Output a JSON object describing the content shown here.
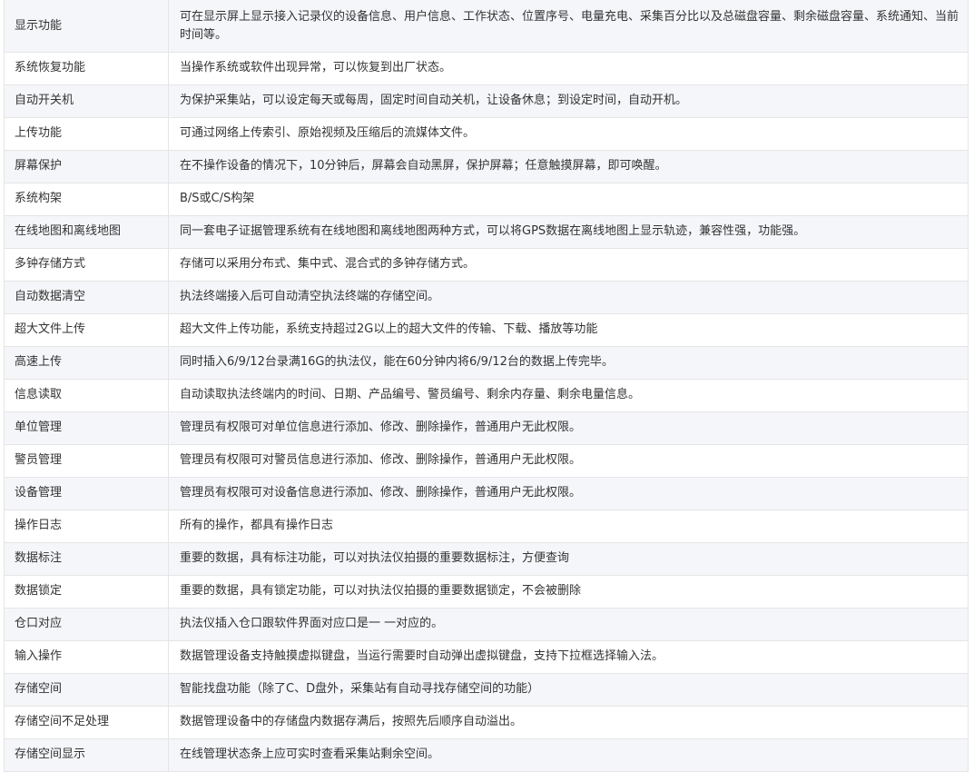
{
  "rows": [
    {
      "feature": "显示功能",
      "description": "可在显示屏上显示接入记录仪的设备信息、用户信息、工作状态、位置序号、电量充电、采集百分比以及总磁盘容量、剩余磁盘容量、系统通知、当前时间等。"
    },
    {
      "feature": "系统恢复功能",
      "description": "当操作系统或软件出现异常，可以恢复到出厂状态。"
    },
    {
      "feature": "自动开关机",
      "description": "为保护采集站，可以设定每天或每周，固定时间自动关机，让设备休息；到设定时间，自动开机。"
    },
    {
      "feature": "上传功能",
      "description": "可通过网络上传索引、原始视频及压缩后的流媒体文件。"
    },
    {
      "feature": "屏幕保护",
      "description": "在不操作设备的情况下，10分钟后，屏幕会自动黑屏，保护屏幕；任意触摸屏幕，即可唤醒。"
    },
    {
      "feature": "系统构架",
      "description": "B/S或C/S构架"
    },
    {
      "feature": "在线地图和离线地图",
      "description": "同一套电子证据管理系统有在线地图和离线地图两种方式，可以将GPS数据在离线地图上显示轨迹，兼容性强，功能强。"
    },
    {
      "feature": "多钟存储方式",
      "description": "存储可以采用分布式、集中式、混合式的多钟存储方式。"
    },
    {
      "feature": "自动数据清空",
      "description": "执法终端接入后可自动清空执法终端的存储空间。"
    },
    {
      "feature": "超大文件上传",
      "description": "超大文件上传功能，系统支持超过2G以上的超大文件的传输、下载、播放等功能"
    },
    {
      "feature": "高速上传",
      "description": "同时插入6/9/12台录满16G的执法仪，能在60分钟内将6/9/12台的数据上传完毕。"
    },
    {
      "feature": "信息读取",
      "description": "自动读取执法终端内的时间、日期、产品编号、警员编号、剩余内存量、剩余电量信息。"
    },
    {
      "feature": "单位管理",
      "description": "管理员有权限可对单位信息进行添加、修改、删除操作，普通用户无此权限。"
    },
    {
      "feature": "警员管理",
      "description": "管理员有权限可对警员信息进行添加、修改、删除操作，普通用户无此权限。"
    },
    {
      "feature": "设备管理",
      "description": "管理员有权限可对设备信息进行添加、修改、删除操作，普通用户无此权限。"
    },
    {
      "feature": "操作日志",
      "description": "所有的操作，都具有操作日志"
    },
    {
      "feature": "数据标注",
      "description": "重要的数据，具有标注功能，可以对执法仪拍摄的重要数据标注，方便查询"
    },
    {
      "feature": "数据锁定",
      "description": "重要的数据，具有锁定功能，可以对执法仪拍摄的重要数据锁定，不会被删除"
    },
    {
      "feature": "仓口对应",
      "description": "执法仪插入仓口跟软件界面对应口是一 一对应的。"
    },
    {
      "feature": "输入操作",
      "description": "数据管理设备支持触摸虚拟键盘，当运行需要时自动弹出虚拟键盘，支持下拉框选择输入法。"
    },
    {
      "feature": "存储空间",
      "description": "智能找盘功能（除了C、D盘外，采集站有自动寻找存储空间的功能）"
    },
    {
      "feature": "存储空间不足处理",
      "description": "数据管理设备中的存储盘内数据存满后，按照先后顺序自动溢出。"
    },
    {
      "feature": "存储空间显示",
      "description": "在线管理状态条上应可实时查看采集站剩余空间。"
    }
  ]
}
